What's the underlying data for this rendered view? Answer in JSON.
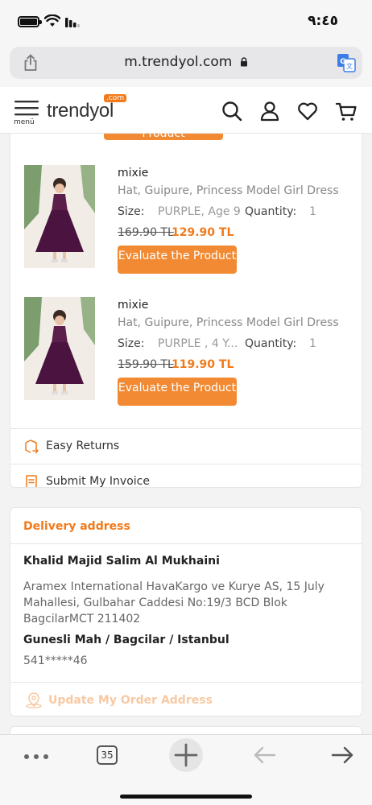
{
  "status_bar": {
    "time": "٩:٤٥"
  },
  "browser": {
    "url": "m.trendyol.com",
    "tab_count": "35"
  },
  "header": {
    "menu_label": "menü",
    "logo_text": "trendyol",
    "logo_com": ".com"
  },
  "partial_button_label": "Product",
  "products": [
    {
      "brand": "mixie",
      "name": "Hat, Guipure, Princess Model Girl Dress",
      "size_label": "Size:",
      "size_value": "PURPLE, Age 9",
      "quantity_label": "Quantity:",
      "quantity_value": "1",
      "old_price": "169.90 TL",
      "new_price": "129.90 TL",
      "button_label": "Evaluate the Product"
    },
    {
      "brand": "mixie",
      "name": "Hat, Guipure, Princess Model Girl Dress",
      "size_label": "Size:",
      "size_value": "PURPLE , 4 Y...",
      "quantity_label": "Quantity:",
      "quantity_value": "1",
      "old_price": "159.90 TL",
      "new_price": "119.90 TL",
      "button_label": "Evaluate the Product"
    }
  ],
  "actions": {
    "easy_returns": "Easy Returns",
    "submit_invoice": "Submit My Invoice"
  },
  "delivery": {
    "title": "Delivery address",
    "name": "Khalid Majid Salim Al Mukhaini",
    "address": "Aramex International HavaKargo ve Kurye AS, 15 July Mahallesi, Gulbahar Caddesi No:19/3 BCD Blok BagcilarMCT 211402",
    "city": "Gunesli Mah / Bagcilar / Istanbul",
    "phone": "541*****46",
    "update_label": "Update My Order Address"
  },
  "colors": {
    "brand_orange": "#f27a1a",
    "button_orange": "#f28a33",
    "update_disabled": "#f8c9a2"
  }
}
